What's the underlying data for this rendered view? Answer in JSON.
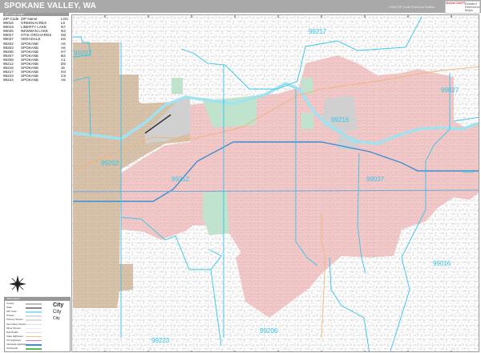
{
  "header": {
    "title": "SPOKANE VALLEY, WA",
    "edition": "2026 ZIP Code Premium Edition",
    "logo_text": "Market MAPS",
    "logo_subtext": "Detailed Reference Maps"
  },
  "zip_table": {
    "caption": "ZIP Code Index",
    "columns": [
      "ZIP Code",
      "ZIP Name",
      "LOC"
    ],
    "rows": [
      [
        "99016",
        "GREENACRES",
        "L6"
      ],
      [
        "99019",
        "LIBERTY LAKE",
        "N7"
      ],
      [
        "99025",
        "NEWMAN LAKE",
        "N2"
      ],
      [
        "99027",
        "OTIS ORCHARDS",
        "M2"
      ],
      [
        "99037",
        "VERADALE",
        "K8"
      ],
      [
        "99202",
        "SPOKANE",
        "A6"
      ],
      [
        "99203",
        "SPOKANE",
        "A6"
      ],
      [
        "99206",
        "SPOKANE",
        "H7"
      ],
      [
        "99207",
        "SPOKANE",
        "B3"
      ],
      [
        "99208",
        "SPOKANE",
        "A1"
      ],
      [
        "99212",
        "SPOKANE",
        "D5"
      ],
      [
        "99216",
        "SPOKANE",
        "J5"
      ],
      [
        "99217",
        "SPOKANE",
        "H3"
      ],
      [
        "99223",
        "SPOKANE",
        "C9"
      ],
      [
        "99224",
        "SPOKANE",
        "A6"
      ]
    ]
  },
  "map": {
    "zip_labels": [
      "99217",
      "99207",
      "99027",
      "99216",
      "99202",
      "99212",
      "99037",
      "99013",
      "99016",
      "99206",
      "99223"
    ],
    "colors": {
      "spokane_valley": "#f4c9c9",
      "spokane": "#d9c3ab",
      "zip_boundary": "#36c5ea",
      "river": "#9fe3f0",
      "interstate": "#3a8fd4",
      "park": "#bfe3cc",
      "airport": "#d0d0d0",
      "highway": "#f2b37a"
    }
  },
  "legend": {
    "title": "Map Legend",
    "items": [
      "County",
      "State",
      "ZIP Code",
      "Streets",
      "Primary Streets",
      "Secondary Streets",
      "Minor Streets",
      "Rail Roads",
      "State Highways",
      "US Highways",
      "Interstate Highways",
      "Toll Roads"
    ],
    "city_label": "City"
  }
}
